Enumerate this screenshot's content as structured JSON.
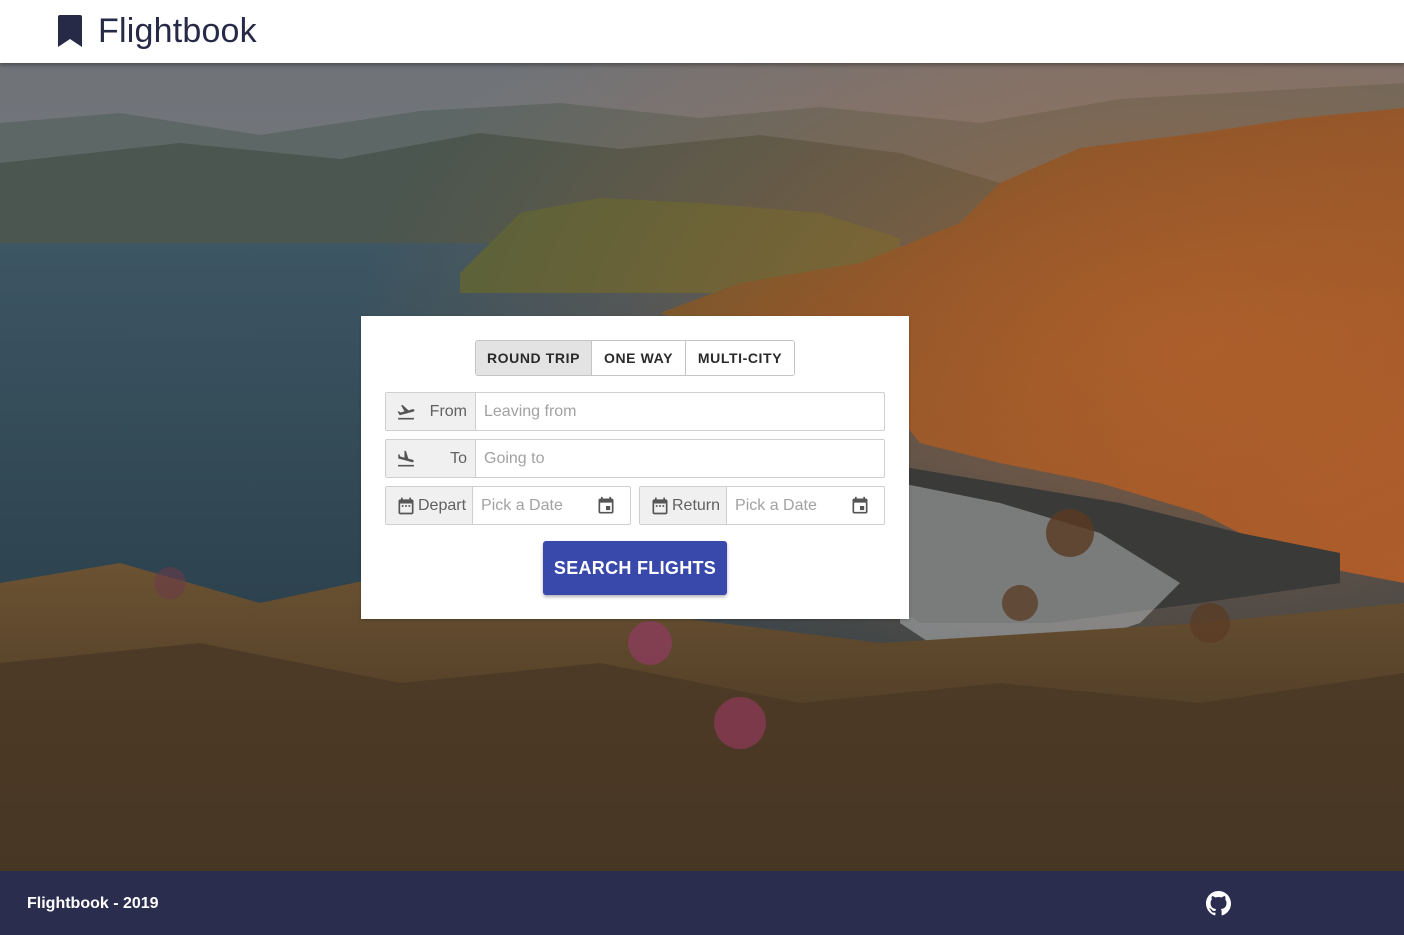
{
  "header": {
    "brand": "Flightbook",
    "brand_icon": "bookmark-icon"
  },
  "search": {
    "trip_types": [
      {
        "label": "ROUND TRIP",
        "active": true
      },
      {
        "label": "ONE WAY",
        "active": false
      },
      {
        "label": "MULTI-CITY",
        "active": false
      }
    ],
    "from": {
      "label": "From",
      "placeholder": "Leaving from",
      "icon": "airplane-takeoff-icon"
    },
    "to": {
      "label": "To",
      "placeholder": "Going to",
      "icon": "airplane-landing-icon"
    },
    "depart": {
      "label": "Depart",
      "placeholder": "Pick a Date",
      "icon": "calendar-icon"
    },
    "return": {
      "label": "Return",
      "placeholder": "Pick a Date",
      "icon": "calendar-icon"
    },
    "button": "SEARCH FLIGHTS"
  },
  "footer": {
    "text": "Flightbook - 2019",
    "icon": "github-icon"
  },
  "colors": {
    "header_bg": "#ffffff",
    "footer_bg": "#2b2d4e",
    "primary_button": "#3949ab",
    "brand_text": "#262a47"
  }
}
